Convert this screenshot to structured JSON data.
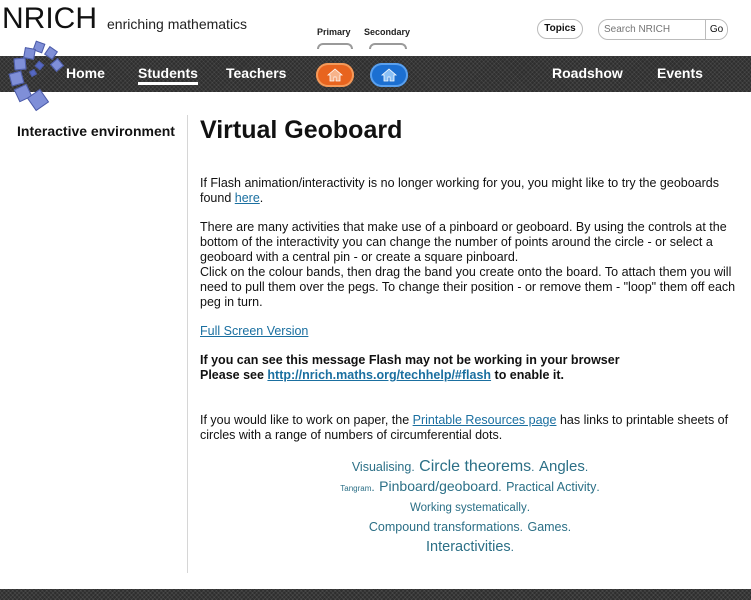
{
  "header": {
    "brand": "NRICH",
    "tagline": "enriching mathematics",
    "topics_label": "Topics",
    "search_placeholder": "Search NRICH",
    "search_go": "Go",
    "stage_primary": "Primary",
    "stage_secondary": "Secondary"
  },
  "nav": {
    "home": "Home",
    "students": "Students",
    "teachers": "Teachers",
    "roadshow": "Roadshow",
    "events": "Events",
    "active": "Students",
    "primary_color": "#e8641f",
    "secondary_color": "#1c6fd1"
  },
  "sidebar": {
    "title": "Interactive environment"
  },
  "main": {
    "title": "Virtual Geoboard",
    "p1_text": "If Flash animation/interactivity is no longer working for you, you might like to try the geoboards found ",
    "p1_link": "here",
    "p1_end": ".",
    "p2_line1": "There are many activities that make use of a pinboard or geoboard. By using the controls at the bottom of the interactivity you can change the number of points around the circle - or select a geoboard with a central pin - or create a square pinboard.",
    "p2_line2": "Click on the colour bands, then drag the band you create onto the board. To attach them you will need to pull them over the pegs. To change their position - or remove them - \"loop\" them off each peg in turn.",
    "fullscreen_link": "Full Screen Version",
    "flash_msg1": "If you can see this message Flash may not be working in your browser",
    "flash_msg2_pre": "Please see ",
    "flash_msg2_link": "http://nrich.maths.org/techhelp/#flash",
    "flash_msg2_post": " to enable it.",
    "paper_pre": "If you would like to work on paper, the ",
    "paper_link": "Printable Resources page",
    "paper_post": " has links to printable sheets of circles with a range of numbers of circumferential dots."
  },
  "tags": {
    "t1": "Visualising",
    "t2": "Circle theorems",
    "t3": "Angles",
    "t4": "Tangram",
    "t5": "Pinboard/geoboard",
    "t6": "Practical Activity",
    "t7": "Working systematically",
    "t8": "Compound transformations",
    "t9": "Games",
    "t10": "Interactivities",
    "dot": "."
  }
}
